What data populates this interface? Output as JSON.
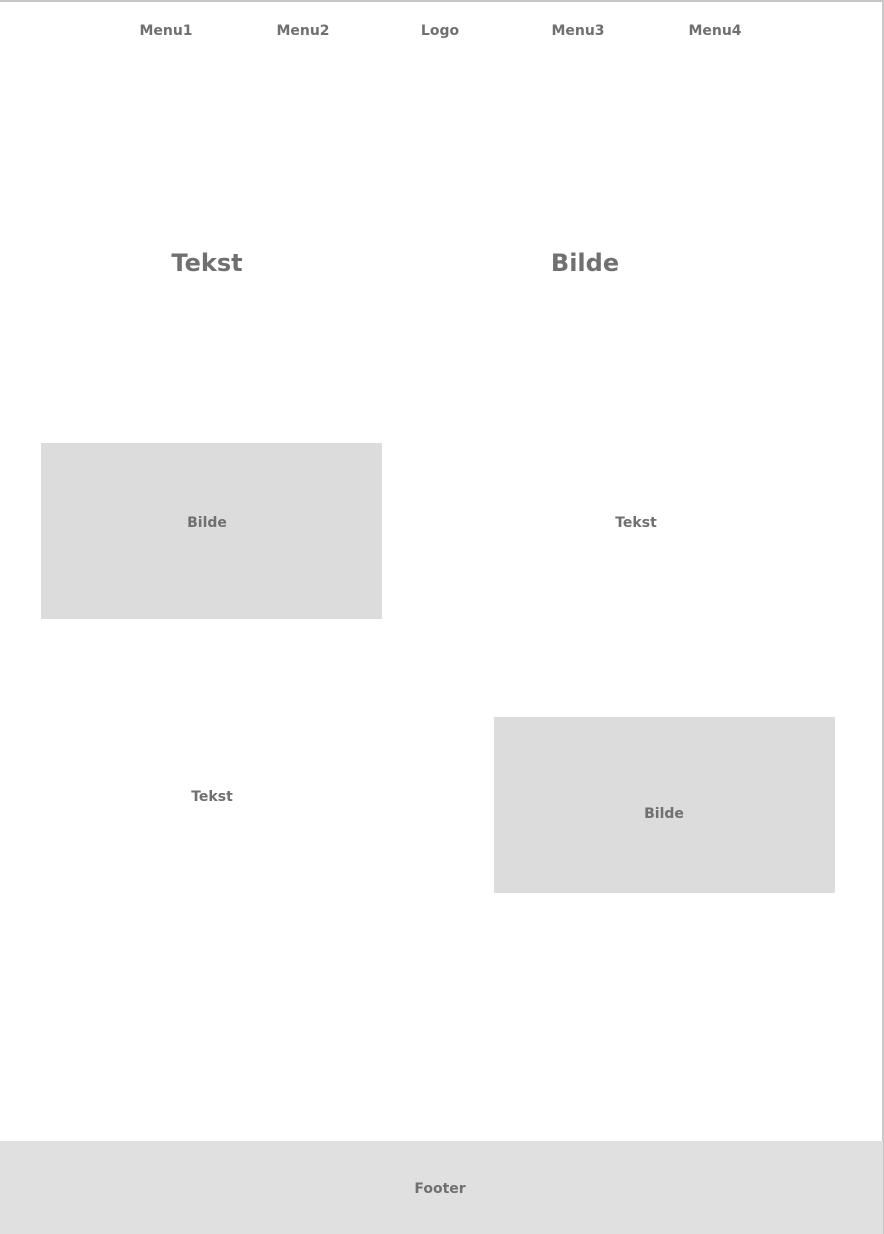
{
  "nav": {
    "items": [
      "Menu1",
      "Menu2",
      "Logo",
      "Menu3",
      "Menu4"
    ]
  },
  "hero": {
    "text_label": "Tekst",
    "image_label": "Bilde"
  },
  "section1": {
    "image_label": "Bilde",
    "text_label": "Tekst"
  },
  "section2": {
    "text_label": "Tekst",
    "image_label": "Bilde"
  },
  "footer": {
    "label": "Footer"
  },
  "colors": {
    "text": "#707070",
    "placeholder_fill": "#dcdcdc",
    "footer_fill": "#e0e0e0",
    "frame_border": "#c8c8c8"
  }
}
